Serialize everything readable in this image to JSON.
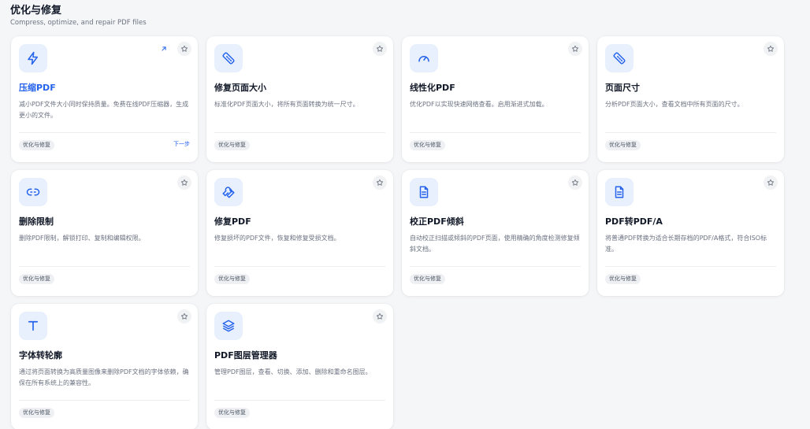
{
  "header": {
    "title": "优化与修复",
    "subtitle": "Compress, optimize, and repair PDF files"
  },
  "cards": [
    {
      "title": "压缩PDF",
      "desc": "减小PDF文件大小同时保持质量。免费在线PDF压缩器，生成更小的文件。",
      "tag": "优化与修复",
      "icon": "zap-icon",
      "next": "下一步"
    },
    {
      "title": "修复页面大小",
      "desc": "标准化PDF页面大小，将所有页面转换为统一尺寸。",
      "tag": "优化与修复",
      "icon": "ruler-icon"
    },
    {
      "title": "线性化PDF",
      "desc": "优化PDF以实现快速网络查看。启用渐进式加载。",
      "tag": "优化与修复",
      "icon": "gauge-icon"
    },
    {
      "title": "页面尺寸",
      "desc": "分析PDF页面大小，查看文档中所有页面的尺寸。",
      "tag": "优化与修复",
      "icon": "ruler-icon"
    },
    {
      "title": "删除限制",
      "desc": "删除PDF限制，解锁打印、复制和编辑权限。",
      "tag": "优化与修复",
      "icon": "unlink-icon"
    },
    {
      "title": "修复PDF",
      "desc": "修复损坏的PDF文件，恢复和修复受损文档。",
      "tag": "优化与修复",
      "icon": "wrench-icon"
    },
    {
      "title": "校正PDF倾斜",
      "desc": "自动校正扫描或倾斜的PDF页面，使用精确的角度检测修复倾斜文档。",
      "tag": "优化与修复",
      "icon": "file-icon"
    },
    {
      "title": "PDF转PDF/A",
      "desc": "将普通PDF转换为适合长期存档的PDF/A格式，符合ISO标准。",
      "tag": "优化与修复",
      "icon": "file-icon"
    },
    {
      "title": "字体转轮廓",
      "desc": "通过将页面转换为高质量图像来删除PDF文档的字体依赖，确保在所有系统上的兼容性。",
      "tag": "优化与修复",
      "icon": "type-icon"
    },
    {
      "title": "PDF图层管理器",
      "desc": "管理PDF图层，查看、切换、添加、删除和重命名图层。",
      "tag": "优化与修复",
      "icon": "layers-icon"
    }
  ]
}
